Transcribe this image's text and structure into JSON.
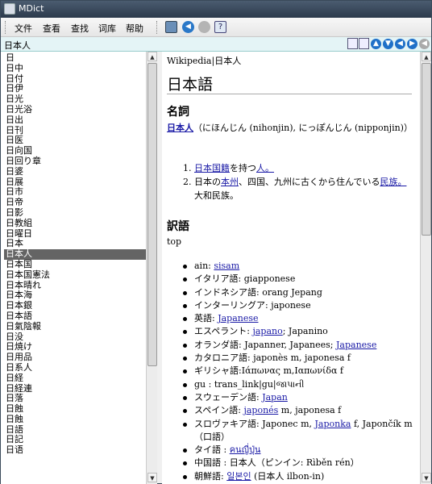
{
  "window": {
    "title": "MDict"
  },
  "menu": [
    "文件",
    "查看",
    "查找",
    "词库",
    "帮助"
  ],
  "toolbar": {
    "icons": [
      "dictionary-icon",
      "back-icon",
      "stop-icon",
      "help-icon"
    ]
  },
  "search": {
    "query": "日本人"
  },
  "word_list": {
    "items": [
      "日",
      "日中",
      "日付",
      "日伊",
      "日光",
      "日光浴",
      "日出",
      "日刊",
      "日医",
      "日向国",
      "日回り章",
      "日婆",
      "日展",
      "日市",
      "日帝",
      "日影",
      "日教組",
      "日曜日",
      "日本",
      "日本人",
      "日本国",
      "日本国憲法",
      "日本晴れ",
      "日本海",
      "日本銀",
      "日本語",
      "日氣陰報",
      "日没",
      "日焼け",
      "日用品",
      "日系人",
      "日経",
      "日経連",
      "日落",
      "日蝕",
      "日蝕",
      "日語",
      "日記",
      "日语"
    ],
    "selected_index": 19
  },
  "article": {
    "breadcrumb": "Wikipedia|日本人",
    "title": "日本語",
    "pos_heading": "名詞",
    "headword": "日本人",
    "reading": "（にほんじん (nihonjin), にっぽんじん (nipponjin)）",
    "definitions": [
      {
        "parts": [
          {
            "t": "日本",
            "link": true
          },
          {
            "t": "国籍",
            "link": true
          },
          {
            "t": "を持つ",
            "link": false
          },
          {
            "t": "人。",
            "link": true
          }
        ]
      },
      {
        "parts": [
          {
            "t": "日本の",
            "link": false
          },
          {
            "t": "本州",
            "link": true
          },
          {
            "t": "、四国、九州に古くから住んでいる",
            "link": false
          },
          {
            "t": "民族。",
            "link": true
          },
          {
            "t": "大和民族。",
            "link": false
          }
        ]
      }
    ],
    "translations_heading": "訳語",
    "top_label": "top",
    "translations": [
      {
        "lang": "ain: ",
        "value": "sisam",
        "link": true
      },
      {
        "lang": "イタリア語: ",
        "value": "giapponese",
        "link": false
      },
      {
        "lang": "インドネシア語: ",
        "value": "orang Jepang",
        "link": false
      },
      {
        "lang": "インターリングア: ",
        "value": "japonese",
        "link": false
      },
      {
        "lang": "英語: ",
        "value": "Japanese",
        "link": true
      },
      {
        "lang": "エスペラント: ",
        "value": "japano",
        "link": true,
        "extra": "; Japanino"
      },
      {
        "lang": "オランダ語: ",
        "value": "Japanner, Japanees; ",
        "link": false,
        "extra_link": "Japanese"
      },
      {
        "lang": "カタロニア語: ",
        "value": "japonès m, japonesa f",
        "link": false
      },
      {
        "lang": "ギリシャ語:",
        "value": "Ιάπωνας m,Ιαπωνίδα f",
        "link": false
      },
      {
        "lang": "gu : trans_link|gu|",
        "value": "જાપાની",
        "link": false
      },
      {
        "lang": "スウェーデン語: ",
        "value": "Japan",
        "link": true
      },
      {
        "lang": "スペイン語: ",
        "value": "japonés",
        "link": true,
        "extra": " m, japonesa f"
      },
      {
        "lang": "スロヴァキア語: ",
        "value": "Japonec m, ",
        "link": false,
        "extra_link": "Japonka",
        "extra": " f, Japončík m （口語）"
      },
      {
        "lang": "タイ語 : ",
        "value": "คนญี่ปุ่น",
        "link": true
      },
      {
        "lang": "中国語 : ",
        "value": "日本人（ピンイン: Rìběn rén）",
        "link": false
      },
      {
        "lang": "朝鮮語: ",
        "value": "일본인",
        "link": true,
        "extra": " (日本人 ilbon-in)"
      }
    ]
  },
  "colors": {
    "selected_row": "#646464",
    "link": "#1a1aa6",
    "search_bg": "#e4f4f6"
  }
}
